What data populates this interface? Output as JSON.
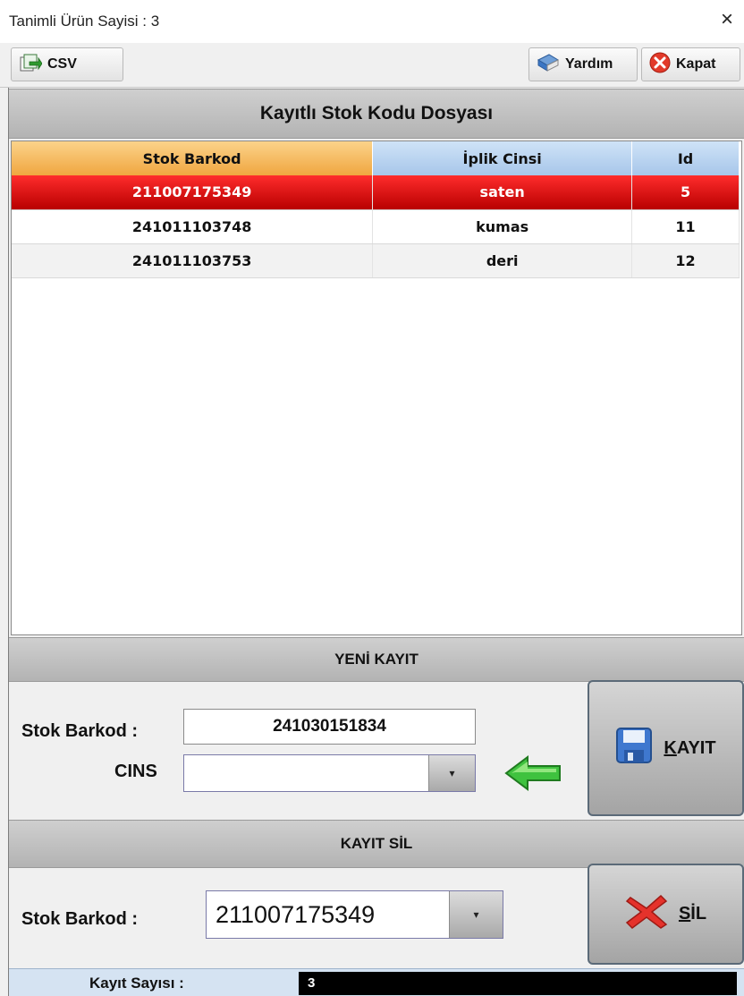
{
  "window": {
    "title": "Tanimli Ürün Sayisi : 3",
    "close_glyph": "×"
  },
  "toolbar": {
    "csv_label": "CSV",
    "help_label": "Yardım",
    "close_label": "Kapat",
    "icons": {
      "csv": "csv-export-icon",
      "help": "help-book-icon",
      "close": "close-circle-icon"
    }
  },
  "main": {
    "section_title": "Kayıtlı Stok Kodu Dosyası",
    "columns": [
      "Stok Barkod",
      "İplik Cinsi",
      "Id"
    ],
    "rows": [
      {
        "barkod": "211007175349",
        "cins": "saten",
        "id": "5",
        "selected": true
      },
      {
        "barkod": "241011103748",
        "cins": "kumas",
        "id": "11",
        "selected": false
      },
      {
        "barkod": "241011103753",
        "cins": "deri",
        "id": "12",
        "selected": false
      }
    ]
  },
  "new_record": {
    "section_title": "YENİ KAYIT",
    "barkod_label": "Stok Barkod :",
    "barkod_value": "241030151834",
    "cins_label": "CINS",
    "cins_value": "",
    "save_label": "KAYIT",
    "save_mnemonic": "K",
    "save_rest": "AYIT"
  },
  "delete_record": {
    "section_title": "KAYIT SİL",
    "barkod_label": "Stok Barkod :",
    "barkod_value": "211007175349",
    "delete_mnemonic": "S",
    "delete_rest": "İL"
  },
  "status": {
    "count_label": "Kayıt Sayısı :",
    "count_value": "3"
  },
  "colors": {
    "selected_row": "#d40000",
    "header_orange": "#f0a640",
    "header_blue": "#a7c6ea",
    "section_gray": "#b3b3b3",
    "status_bg": "#d5e3f2"
  }
}
